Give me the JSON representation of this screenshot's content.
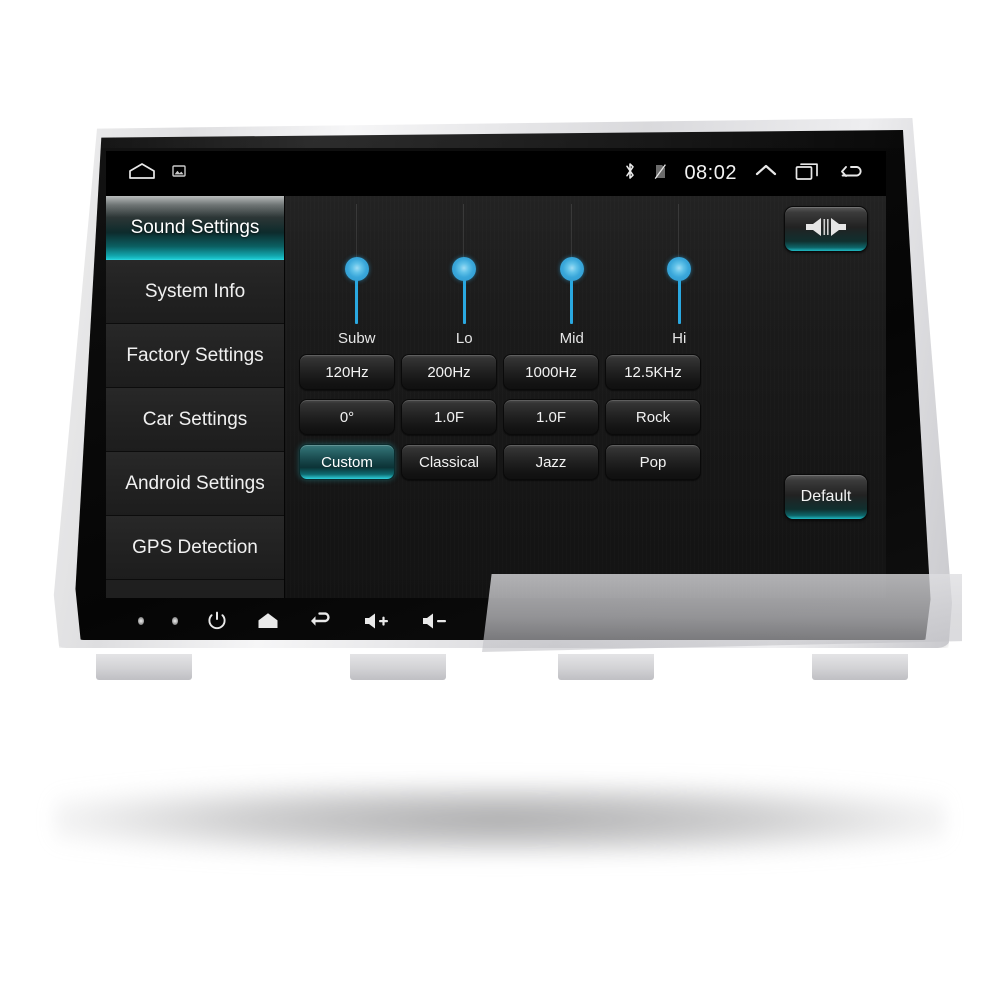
{
  "statusbar": {
    "left_icons": [
      {
        "name": "home-icon",
        "glyph": "home"
      },
      {
        "name": "screenshot-icon",
        "glyph": "picture"
      }
    ],
    "bluetooth_icon": "bluetooth-icon",
    "sim_icon": "sim-off-icon",
    "time": "08:02",
    "right_icons": [
      {
        "name": "chevron-up-icon",
        "glyph": "chevron-up"
      },
      {
        "name": "recents-icon",
        "glyph": "recents"
      },
      {
        "name": "back-icon",
        "glyph": "back-arrow"
      }
    ]
  },
  "sidebar": {
    "items": [
      {
        "label": "Sound Settings",
        "selected": true
      },
      {
        "label": "System Info",
        "selected": false
      },
      {
        "label": "Factory Settings",
        "selected": false
      },
      {
        "label": "Car Settings",
        "selected": false
      },
      {
        "label": "Android Settings",
        "selected": false
      },
      {
        "label": "GPS Detection",
        "selected": false
      }
    ]
  },
  "main": {
    "sliders": [
      {
        "label": "Subw",
        "value": 48
      },
      {
        "label": "Lo",
        "value": 48
      },
      {
        "label": "Mid",
        "value": 48
      },
      {
        "label": "Hi",
        "value": 48
      }
    ],
    "balance_button": {
      "name": "balance-fader-button",
      "icon": "balance-speakers-icon"
    },
    "default_button": {
      "label": "Default"
    },
    "button_grid": [
      [
        {
          "label": "120Hz",
          "active": false
        },
        {
          "label": "200Hz",
          "active": false
        },
        {
          "label": "1000Hz",
          "active": false
        },
        {
          "label": "12.5KHz",
          "active": false
        }
      ],
      [
        {
          "label": "0°",
          "active": false
        },
        {
          "label": "1.0F",
          "active": false
        },
        {
          "label": "1.0F",
          "active": false
        },
        {
          "label": "Rock",
          "active": false
        }
      ],
      [
        {
          "label": "Custom",
          "active": true
        },
        {
          "label": "Classical",
          "active": false
        },
        {
          "label": "Jazz",
          "active": false
        },
        {
          "label": "Pop",
          "active": false
        }
      ]
    ]
  },
  "hardware_bar": {
    "buttons": [
      {
        "name": "led-indicator-1",
        "glyph": "dot"
      },
      {
        "name": "led-indicator-2",
        "glyph": "dot"
      },
      {
        "name": "power-button",
        "glyph": "power"
      },
      {
        "name": "home-button",
        "glyph": "home"
      },
      {
        "name": "back-button",
        "glyph": "back-arrow"
      },
      {
        "name": "volume-up-button",
        "glyph": "speaker-plus"
      },
      {
        "name": "volume-down-button",
        "glyph": "speaker-minus"
      }
    ]
  },
  "colors": {
    "accent_teal": "#1ec8d0",
    "slider_blue": "#2aa8e0",
    "screen_black": "#000000",
    "bezel_silver": "#dedee0"
  }
}
